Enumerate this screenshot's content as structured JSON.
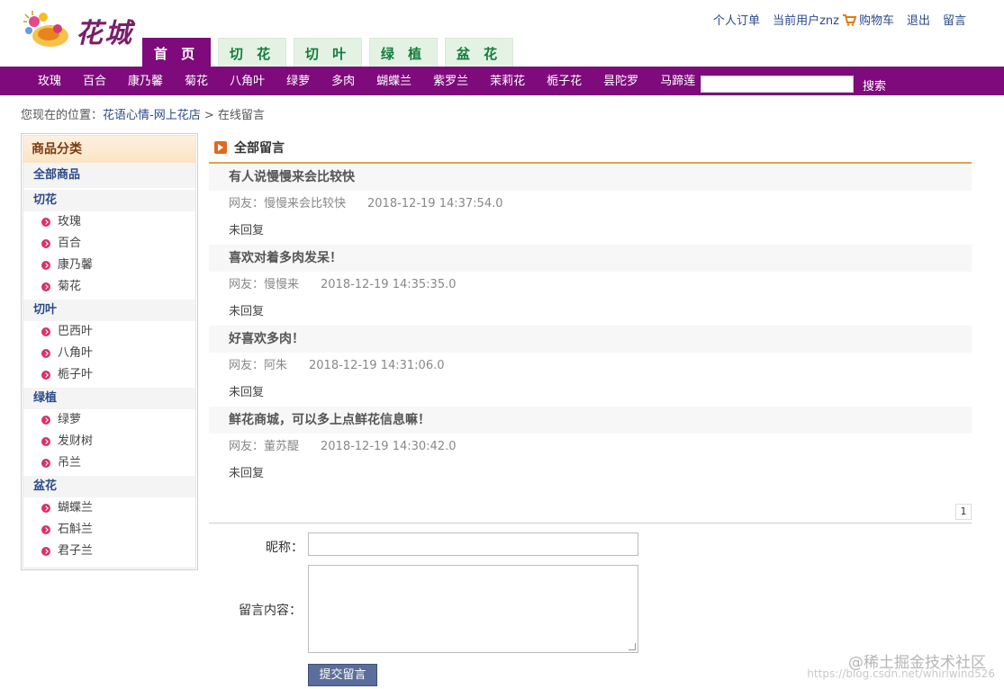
{
  "header": {
    "logo_text": "花城",
    "topnav": {
      "orders": "个人订单",
      "current_user": "当前用户znz",
      "cart": "购物车",
      "logout": "退出",
      "message": "留言"
    },
    "tabs": [
      "首 页",
      "切 花",
      "切 叶",
      "绿 植",
      "盆 花"
    ]
  },
  "catbar": {
    "items": [
      "玫瑰",
      "百合",
      "康乃馨",
      "菊花",
      "八角叶",
      "绿萝",
      "多肉",
      "蝴蝶兰",
      "紫罗兰",
      "茉莉花",
      "栀子花",
      "昙陀罗",
      "马蹄莲"
    ],
    "search_button": "搜索",
    "search_value": ""
  },
  "breadcrumb": {
    "prefix": "您现在的位置：",
    "site": "花语心情-网上花店",
    "sep": ">",
    "current": "在线留言"
  },
  "sidebar": {
    "title": "商品分类",
    "all": "全部商品",
    "groups": [
      {
        "name": "切花",
        "items": [
          "玫瑰",
          "百合",
          "康乃馨",
          "菊花"
        ]
      },
      {
        "name": "切叶",
        "items": [
          "巴西叶",
          "八角叶",
          "栀子叶"
        ]
      },
      {
        "name": "绿植",
        "items": [
          "绿萝",
          "发财树",
          "吊兰"
        ]
      },
      {
        "name": "盆花",
        "items": [
          "蝴蝶兰",
          "石斛兰",
          "君子兰"
        ]
      }
    ]
  },
  "main": {
    "title": "全部留言",
    "messages": [
      {
        "title": "有人说慢慢来会比较快",
        "author": "网友：慢慢来会比较快",
        "time": "2018-12-19 14:37:54.0",
        "reply": "未回复"
      },
      {
        "title": "喜欢对着多肉发呆！",
        "author": "网友：慢慢来",
        "time": "2018-12-19 14:35:35.0",
        "reply": "未回复"
      },
      {
        "title": "好喜欢多肉！",
        "author": "网友：阿朱",
        "time": "2018-12-19 14:31:06.0",
        "reply": "未回复"
      },
      {
        "title": "鲜花商城，可以多上点鲜花信息嘛！",
        "author": "网友：董苏醍",
        "time": "2018-12-19 14:30:42.0",
        "reply": "未回复"
      }
    ],
    "page": "1"
  },
  "form": {
    "nickname_label": "昵称：",
    "nickname_value": "",
    "content_label": "留言内容：",
    "content_value": "",
    "submit_label": "提交留言"
  },
  "watermark": {
    "main": "@稀土掘金技术社区",
    "url": "https://blog.csdn.net/whirlwind526"
  },
  "colors": {
    "brand_purple": "#7e0a7c",
    "tab_green": "#137c3b",
    "accent_orange": "#e0a24d",
    "submit_blue": "#5b6e9b"
  }
}
